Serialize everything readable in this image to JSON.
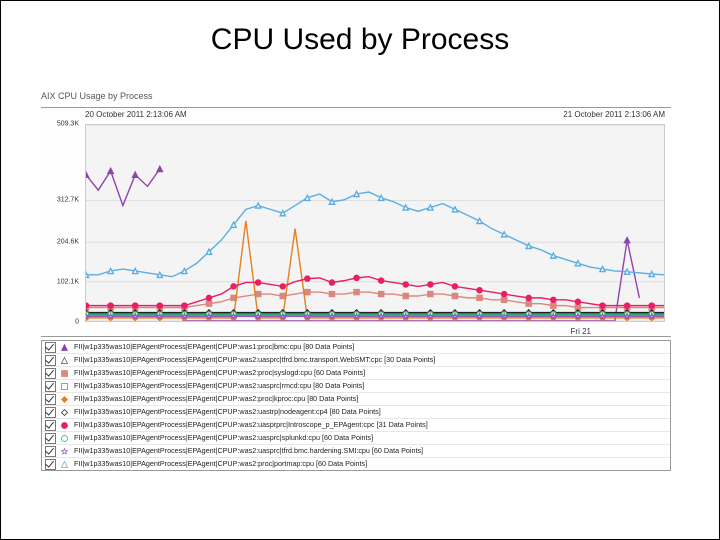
{
  "slide": {
    "title": "CPU Used by Process"
  },
  "panel": {
    "title": "AIX CPU Usage by Process",
    "time_start": "20 October 2011 2:13:06 AM",
    "time_end": "21 October 2011 2:13:06 AM",
    "x_major_label": "Fri 21"
  },
  "chart_data": {
    "type": "line",
    "xlabel": "",
    "ylabel": "",
    "ylim": [
      0,
      509300
    ],
    "yticks": [
      0,
      102100,
      204600,
      312700,
      509300
    ],
    "ytick_labels": [
      "0",
      "102.1K",
      "204.6K",
      "312.7K",
      "509.3K"
    ],
    "x": [
      0,
      1,
      2,
      3,
      4,
      5,
      6,
      7,
      8,
      9,
      10,
      11,
      12,
      13,
      14,
      15,
      16,
      17,
      18,
      19,
      20,
      21,
      22,
      23,
      24,
      25,
      26,
      27,
      28,
      29,
      30,
      31,
      32,
      33,
      34,
      35,
      36,
      37,
      38,
      39,
      40,
      41,
      42,
      43,
      44,
      45,
      46,
      47
    ],
    "series": [
      {
        "name": "FII|w1p335was10|EPAgentProcess|EPAgent|CPUP:was1:proc|bmc:cpu",
        "points": 80,
        "color": "#8e44ad",
        "marker": "triangle",
        "filled": true,
        "values": [
          380000,
          340000,
          390000,
          300000,
          380000,
          350000,
          395000,
          null,
          0,
          0,
          0,
          0,
          0,
          0,
          0,
          0,
          0,
          0,
          0,
          0,
          0,
          0,
          0,
          0,
          0,
          0,
          0,
          0,
          0,
          0,
          0,
          0,
          0,
          0,
          0,
          0,
          0,
          0,
          0,
          0,
          0,
          0,
          0,
          0,
          210000,
          60000,
          null,
          null
        ]
      },
      {
        "name": "FII|w1p335was10|EPAgentProcess|EPAgent|CPUP:was2:uasprc|tfrd.bmc.transport.WebSMT:cpc",
        "points": 30,
        "color": "#555555",
        "marker": "triangle",
        "filled": false,
        "values": [
          20000,
          20000,
          20000,
          20000,
          20000,
          20000,
          20000,
          20000,
          20000,
          20000,
          20000,
          20000,
          20000,
          20000,
          20000,
          20000,
          20000,
          20000,
          20000,
          20000,
          20000,
          20000,
          20000,
          20000,
          20000,
          20000,
          20000,
          20000,
          20000,
          20000,
          20000,
          20000,
          20000,
          20000,
          20000,
          20000,
          20000,
          20000,
          20000,
          20000,
          20000,
          20000,
          20000,
          20000,
          20000,
          20000,
          20000,
          20000
        ]
      },
      {
        "name": "FII|w1p335was10|EPAgentProcess|EPAgent|CPUP:was2:proc|syslogd:cpu",
        "points": 60,
        "color": "#d98880",
        "marker": "square",
        "filled": true,
        "values": [
          35000,
          35000,
          35000,
          35000,
          35000,
          35000,
          35000,
          35000,
          35000,
          40000,
          45000,
          50000,
          60000,
          65000,
          70000,
          70000,
          65000,
          70000,
          75000,
          75000,
          70000,
          70000,
          75000,
          75000,
          70000,
          70000,
          65000,
          65000,
          70000,
          70000,
          65000,
          60000,
          60000,
          55000,
          55000,
          50000,
          45000,
          45000,
          40000,
          40000,
          35000,
          35000,
          35000,
          35000,
          35000,
          35000,
          35000,
          35000
        ]
      },
      {
        "name": "FII|w1p335was10|EPAgentProcess|EPAgent|CPUP:was2:uasprc|rmcd:cpu",
        "points": 80,
        "color": "#3498db",
        "marker": "square",
        "filled": false,
        "values": [
          15000,
          15000,
          15000,
          15000,
          15000,
          15000,
          15000,
          15000,
          15000,
          15000,
          15000,
          15000,
          15000,
          15000,
          15000,
          15000,
          15000,
          15000,
          15000,
          15000,
          15000,
          15000,
          15000,
          15000,
          15000,
          15000,
          15000,
          15000,
          15000,
          15000,
          15000,
          15000,
          15000,
          15000,
          15000,
          15000,
          15000,
          15000,
          15000,
          15000,
          15000,
          15000,
          15000,
          15000,
          15000,
          15000,
          15000,
          15000
        ]
      },
      {
        "name": "FII|w1p335was10|EPAgentProcess|EPAgent|CPUP:was2:proc|kproc:cpu",
        "points": 80,
        "color": "#e67e22",
        "marker": "diamond",
        "filled": true,
        "values": [
          8000,
          8000,
          8000,
          8000,
          8000,
          8000,
          8000,
          8000,
          8000,
          8000,
          8000,
          8000,
          8000,
          260000,
          8000,
          8000,
          8000,
          240000,
          8000,
          8000,
          8000,
          8000,
          8000,
          8000,
          8000,
          8000,
          8000,
          8000,
          8000,
          8000,
          8000,
          8000,
          8000,
          8000,
          8000,
          8000,
          8000,
          8000,
          8000,
          8000,
          8000,
          8000,
          8000,
          8000,
          8000,
          8000,
          8000,
          8000
        ]
      },
      {
        "name": "FII|w1p335was10|EPAgentProcess|EPAgent|CPUP:was2:uastrp|nodeagent:cp4",
        "points": 80,
        "color": "#222222",
        "marker": "diamond",
        "filled": false,
        "values": [
          22000,
          22000,
          22000,
          22000,
          22000,
          22000,
          22000,
          22000,
          22000,
          22000,
          22000,
          22000,
          22000,
          22000,
          22000,
          22000,
          22000,
          22000,
          22000,
          22000,
          22000,
          22000,
          22000,
          22000,
          22000,
          22000,
          22000,
          22000,
          22000,
          22000,
          22000,
          22000,
          22000,
          22000,
          22000,
          22000,
          22000,
          22000,
          22000,
          22000,
          22000,
          22000,
          22000,
          22000,
          22000,
          22000,
          22000,
          22000
        ]
      },
      {
        "name": "FII|w1p335was10|EPAgentProcess|EPAgent|CPUP:was2:uasprprc|Introscope_p_EPAgent:cpc",
        "points": 31,
        "color": "#e91e63",
        "marker": "circle",
        "filled": true,
        "values": [
          40000,
          40000,
          40000,
          40000,
          40000,
          40000,
          40000,
          40000,
          40000,
          50000,
          60000,
          70000,
          90000,
          100000,
          100000,
          95000,
          90000,
          102000,
          110000,
          112000,
          100000,
          105000,
          112000,
          115000,
          105000,
          100000,
          95000,
          90000,
          95000,
          100000,
          90000,
          85000,
          80000,
          75000,
          70000,
          65000,
          60000,
          60000,
          55000,
          55000,
          50000,
          45000,
          40000,
          40000,
          40000,
          40000,
          40000,
          40000
        ]
      },
      {
        "name": "FII|w1p335was10|EPAgentProcess|EPAgent|CPUP:was2:uasprc|splunkd:cpu",
        "points": 60,
        "color": "#27ae60",
        "marker": "circle",
        "filled": false,
        "values": [
          18000,
          18000,
          18000,
          18000,
          18000,
          18000,
          18000,
          18000,
          18000,
          18000,
          18000,
          18000,
          18000,
          18000,
          18000,
          18000,
          18000,
          18000,
          18000,
          18000,
          18000,
          18000,
          18000,
          18000,
          18000,
          18000,
          18000,
          18000,
          18000,
          18000,
          18000,
          18000,
          18000,
          18000,
          18000,
          18000,
          18000,
          18000,
          18000,
          18000,
          18000,
          18000,
          18000,
          18000,
          18000,
          18000,
          18000,
          18000
        ]
      },
      {
        "name": "FII|w1p335was10|EPAgentProcess|EPAgent|CPUP:was2:uasprc|tfrd.bmc.hardening.SMI:cpu",
        "points": 60,
        "color": "#9b59b6",
        "marker": "star",
        "filled": false,
        "values": [
          12000,
          12000,
          12000,
          12000,
          12000,
          12000,
          12000,
          12000,
          12000,
          12000,
          12000,
          12000,
          12000,
          12000,
          12000,
          12000,
          12000,
          12000,
          12000,
          12000,
          12000,
          12000,
          12000,
          12000,
          12000,
          12000,
          12000,
          12000,
          12000,
          12000,
          12000,
          12000,
          12000,
          12000,
          12000,
          12000,
          12000,
          12000,
          12000,
          12000,
          12000,
          12000,
          12000,
          12000,
          12000,
          12000,
          12000,
          12000
        ]
      },
      {
        "name": "FII|w1p335was10|EPAgentProcess|EPAgent|CPUP:was2:proc|portmap:cpu",
        "points": 60,
        "color": "#5dade2",
        "marker": "triangle",
        "filled": false,
        "values": [
          120000,
          120000,
          130000,
          135000,
          130000,
          125000,
          120000,
          115000,
          130000,
          150000,
          180000,
          210000,
          250000,
          290000,
          300000,
          290000,
          280000,
          300000,
          320000,
          330000,
          310000,
          315000,
          330000,
          335000,
          320000,
          310000,
          295000,
          285000,
          295000,
          305000,
          290000,
          275000,
          260000,
          240000,
          225000,
          210000,
          195000,
          185000,
          170000,
          160000,
          150000,
          140000,
          135000,
          130000,
          128000,
          125000,
          122000,
          120000
        ]
      }
    ]
  }
}
